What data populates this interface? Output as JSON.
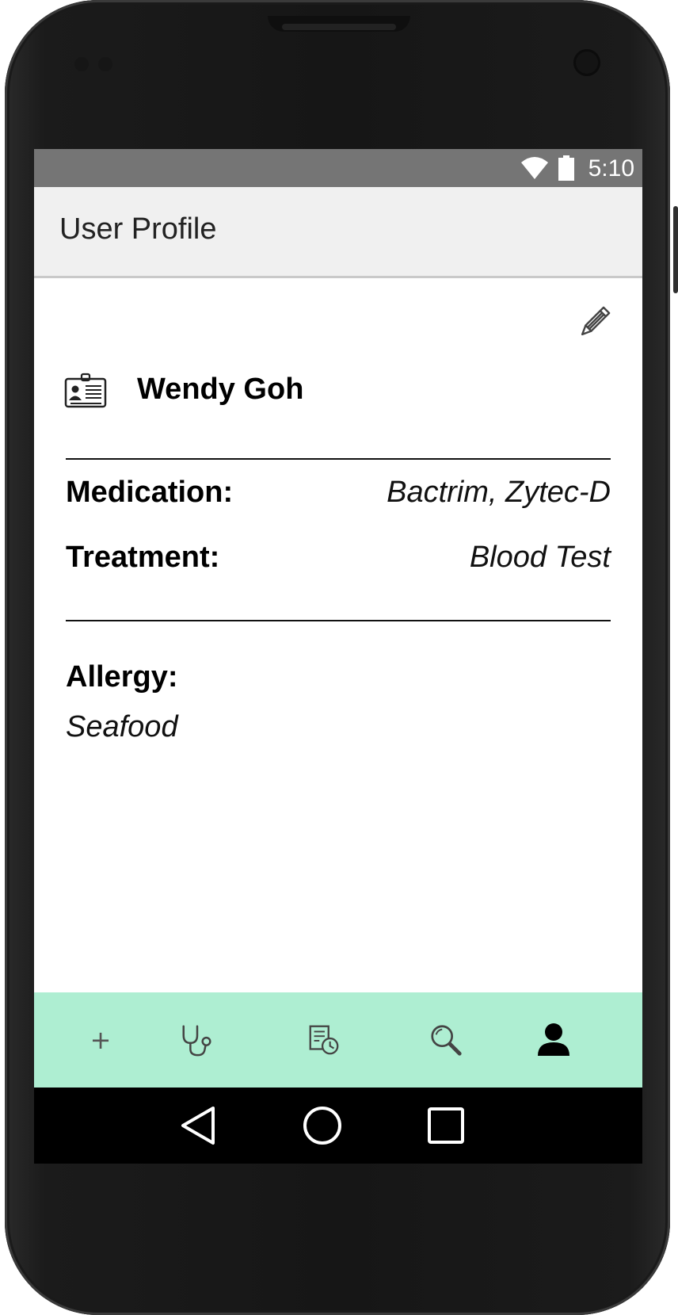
{
  "status_bar": {
    "time": "5:10"
  },
  "app_bar": {
    "title": "User Profile"
  },
  "profile": {
    "name": "Wendy Goh",
    "fields": [
      {
        "label": "Medication:",
        "value": "Bactrim, Zytec-D"
      },
      {
        "label": "Treatment:",
        "value": "Blood Test"
      }
    ],
    "allergy": {
      "label": "Allergy:",
      "value": "Seafood"
    }
  },
  "bottom_nav": {
    "items": [
      {
        "icon": "plus-icon",
        "glyph": "+"
      },
      {
        "icon": "stethoscope-icon"
      },
      {
        "icon": "schedule-icon"
      },
      {
        "icon": "search-icon"
      },
      {
        "icon": "profile-icon",
        "active": true
      }
    ],
    "background": "#aeeed2"
  },
  "icons": {
    "edit": "pencil-icon",
    "id_card": "id-card-icon",
    "system": [
      "back-icon",
      "home-icon",
      "recents-icon"
    ]
  },
  "colors": {
    "status_bar": "#757575",
    "app_bar": "#f0f0f0",
    "nav_bar": "#aeeed2",
    "system_nav": "#000000"
  }
}
